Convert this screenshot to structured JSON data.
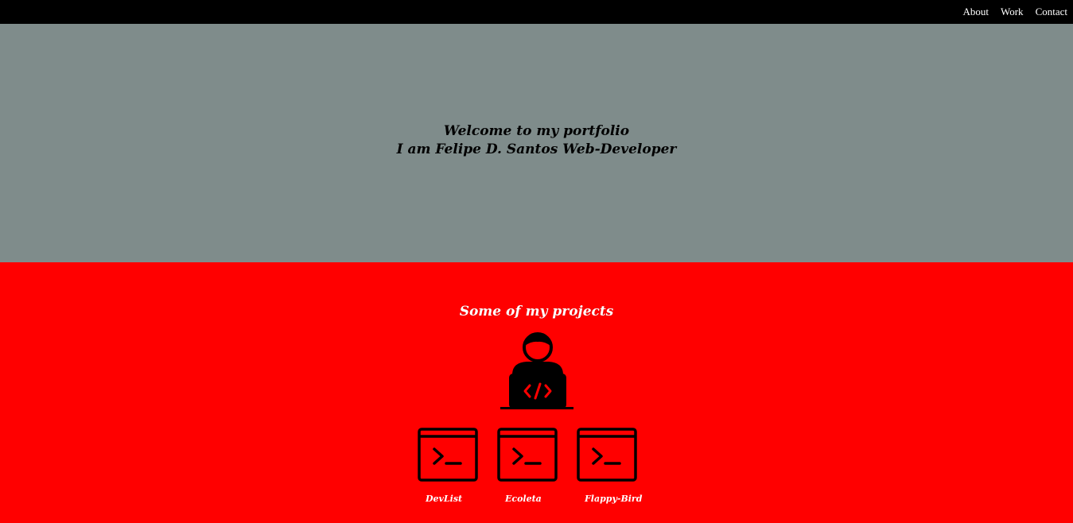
{
  "nav": {
    "items": [
      {
        "label": "About"
      },
      {
        "label": "Work"
      },
      {
        "label": "Contact"
      }
    ]
  },
  "hero": {
    "line1": "Welcome to my portfolio",
    "line2": "I am Felipe D. Santos Web-Developer"
  },
  "projects": {
    "title": "Some of my projects",
    "items": [
      {
        "label": "DevList",
        "icon": "terminal-icon"
      },
      {
        "label": "Ecoleta",
        "icon": "terminal-icon"
      },
      {
        "label": "Flappy-Bird",
        "icon": "terminal-icon"
      }
    ]
  },
  "colors": {
    "topbar": "#000000",
    "hero_bg": "#7f8c8b",
    "projects_bg": "#ff0000",
    "text_light": "#ffffff",
    "text_dark": "#000000"
  }
}
